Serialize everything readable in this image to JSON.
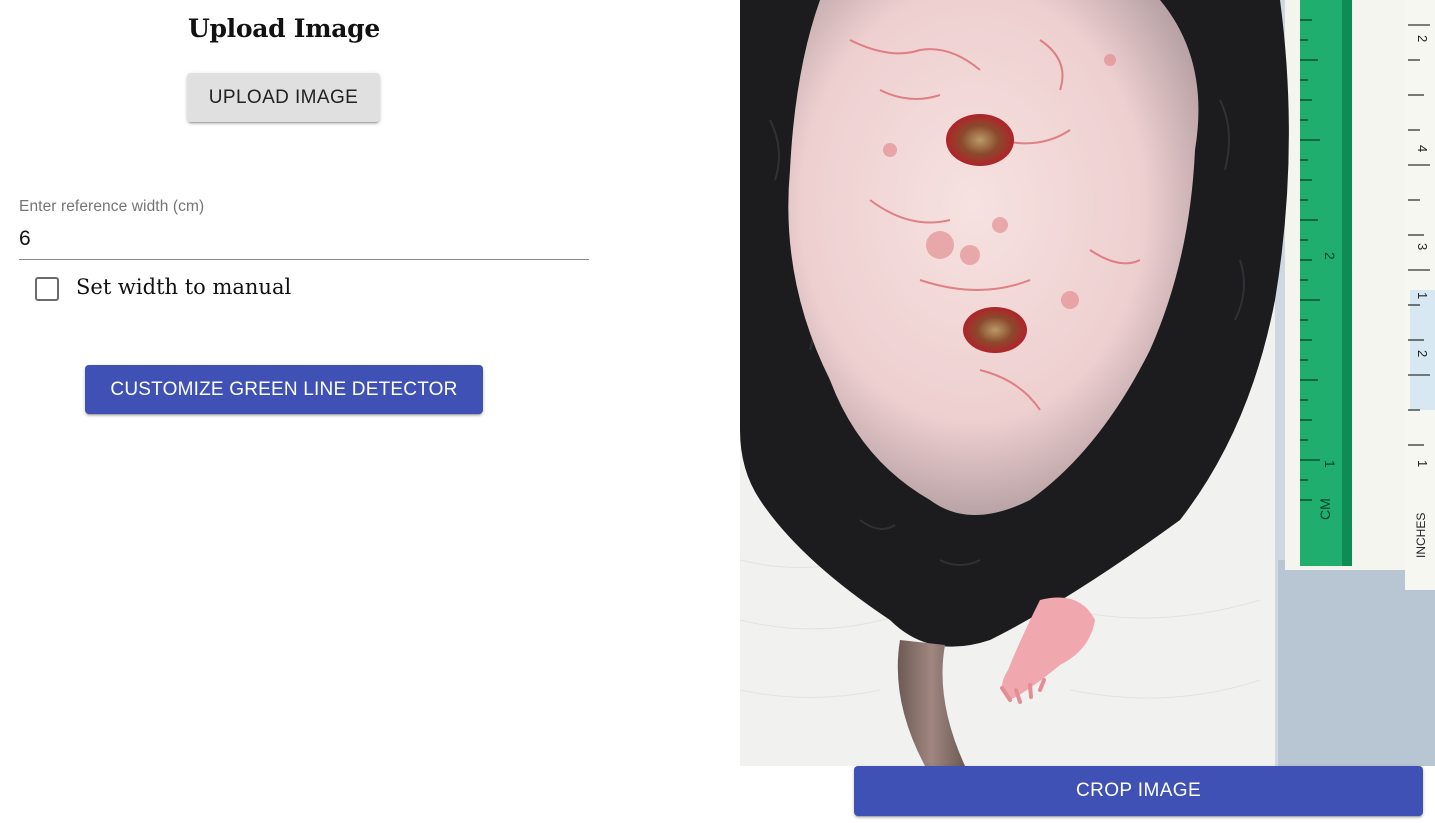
{
  "upload_section": {
    "title": "Upload Image",
    "upload_button_label": "UPLOAD IMAGE"
  },
  "reference_width": {
    "label": "Enter reference width (cm)",
    "value": "6"
  },
  "manual_width": {
    "label": "Set width to manual",
    "checked": false
  },
  "detector_button_label": "CUSTOMIZE GREEN LINE DETECTOR",
  "image_panel": {
    "ruler_cm_ticks": [
      "2",
      "1",
      "CM"
    ],
    "ruler_inch_ticks": [
      "2",
      "4",
      "3",
      "1",
      "2",
      "1",
      "INCHES"
    ],
    "crop_button_label": "CROP IMAGE"
  },
  "colors": {
    "primary": "#3f51b5",
    "secondary_button": "#e0e0e0",
    "ruler_green": "#1fae6e"
  }
}
